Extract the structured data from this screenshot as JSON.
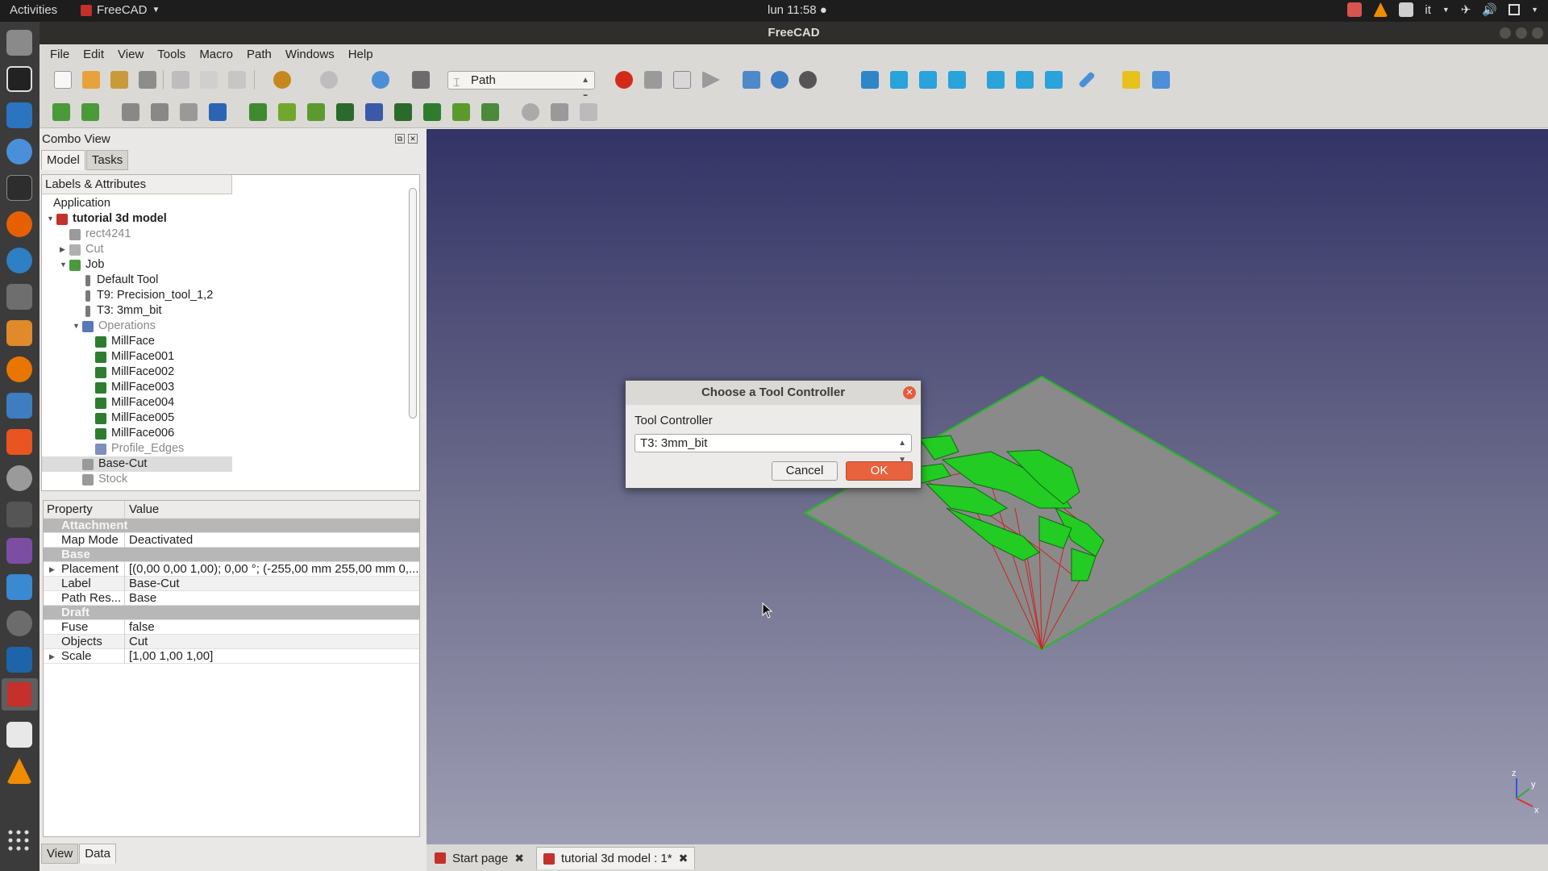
{
  "topbar": {
    "activities": "Activities",
    "app_name": "FreeCAD",
    "clock": "lun 11:58 ●",
    "keyboard": "it"
  },
  "window": {
    "title": "FreeCAD"
  },
  "menu": [
    "File",
    "Edit",
    "View",
    "Tools",
    "Macro",
    "Path",
    "Windows",
    "Help"
  ],
  "workbench": {
    "selected": "Path"
  },
  "combo": {
    "title": "Combo View",
    "tabs": [
      "Model",
      "Tasks"
    ],
    "tree_header": "Labels & Attributes",
    "tree": [
      {
        "label": "Application",
        "indent": 0,
        "style": "normal",
        "twist": "",
        "icon": ""
      },
      {
        "label": "tutorial 3d model",
        "indent": 1,
        "style": "bold",
        "twist": "▼",
        "icon": "doc"
      },
      {
        "label": "rect4241",
        "indent": 2,
        "style": "grey",
        "twist": "",
        "icon": "solid"
      },
      {
        "label": "Cut",
        "indent": 2,
        "style": "grey",
        "twist": "▶",
        "icon": "cut"
      },
      {
        "label": "Job",
        "indent": 2,
        "style": "normal",
        "twist": "▼",
        "icon": "job"
      },
      {
        "label": "Default Tool",
        "indent": 3,
        "style": "normal",
        "twist": "",
        "icon": "tool"
      },
      {
        "label": "T9: Precision_tool_1,2",
        "indent": 3,
        "style": "normal",
        "twist": "",
        "icon": "tool"
      },
      {
        "label": "T3: 3mm_bit",
        "indent": 3,
        "style": "normal",
        "twist": "",
        "icon": "tool"
      },
      {
        "label": "Operations",
        "indent": 3,
        "style": "grey",
        "twist": "▼",
        "icon": "ops"
      },
      {
        "label": "MillFace",
        "indent": 4,
        "style": "normal",
        "twist": "",
        "icon": "mill"
      },
      {
        "label": "MillFace001",
        "indent": 4,
        "style": "normal",
        "twist": "",
        "icon": "mill"
      },
      {
        "label": "MillFace002",
        "indent": 4,
        "style": "normal",
        "twist": "",
        "icon": "mill"
      },
      {
        "label": "MillFace003",
        "indent": 4,
        "style": "normal",
        "twist": "",
        "icon": "mill"
      },
      {
        "label": "MillFace004",
        "indent": 4,
        "style": "normal",
        "twist": "",
        "icon": "mill"
      },
      {
        "label": "MillFace005",
        "indent": 4,
        "style": "normal",
        "twist": "",
        "icon": "mill"
      },
      {
        "label": "MillFace006",
        "indent": 4,
        "style": "normal",
        "twist": "",
        "icon": "mill"
      },
      {
        "label": "Profile_Edges",
        "indent": 4,
        "style": "grey",
        "twist": "",
        "icon": "profile"
      },
      {
        "label": "Base-Cut",
        "indent": 3,
        "style": "sel",
        "twist": "",
        "icon": "solid"
      },
      {
        "label": "Stock",
        "indent": 3,
        "style": "grey",
        "twist": "",
        "icon": "solid"
      }
    ],
    "props": {
      "col_property": "Property",
      "col_value": "Value",
      "rows": [
        {
          "type": "group",
          "name": "Attachment",
          "value": "",
          "expand": false
        },
        {
          "type": "row",
          "name": "Map Mode",
          "value": "Deactivated",
          "expand": false
        },
        {
          "type": "group",
          "name": "Base",
          "value": "",
          "expand": false
        },
        {
          "type": "row",
          "name": "Placement",
          "value": "[(0,00 0,00 1,00); 0,00 °; (-255,00 mm  255,00 mm  0,...",
          "expand": true
        },
        {
          "type": "row",
          "name": "Label",
          "value": "Base-Cut",
          "expand": false
        },
        {
          "type": "row",
          "name": "Path Res...",
          "value": "Base",
          "expand": false
        },
        {
          "type": "group",
          "name": "Draft",
          "value": "",
          "expand": false
        },
        {
          "type": "row",
          "name": "Fuse",
          "value": "false",
          "expand": false
        },
        {
          "type": "row",
          "name": "Objects",
          "value": "Cut",
          "expand": false
        },
        {
          "type": "row",
          "name": "Scale",
          "value": "[1,00 1,00 1,00]",
          "expand": true
        }
      ]
    },
    "bottom_tabs": [
      "View",
      "Data"
    ]
  },
  "doc_tabs": [
    {
      "label": "Start page"
    },
    {
      "label": "tutorial 3d model : 1*"
    }
  ],
  "dialog": {
    "title": "Choose a Tool Controller",
    "field_label": "Tool Controller",
    "selected": "T3: 3mm_bit",
    "cancel": "Cancel",
    "ok": "OK"
  },
  "axis": {
    "x": "x",
    "y": "y",
    "z": "z"
  },
  "colors": {
    "accent": "#e8623e",
    "path_green": "#22cc22",
    "toolpath_red": "#cc2222",
    "view_top": "#333366",
    "view_bottom": "#9d9db3"
  }
}
